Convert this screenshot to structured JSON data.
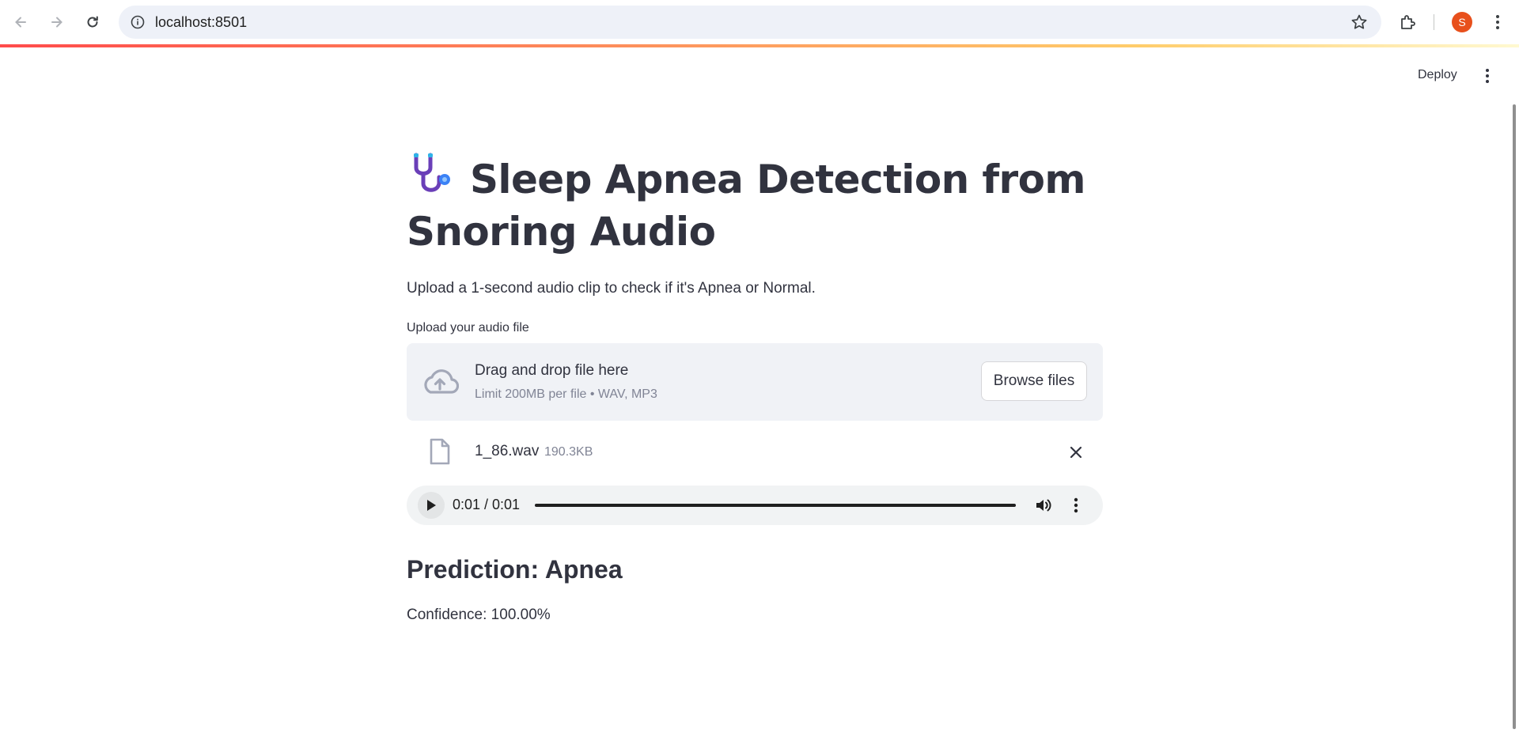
{
  "browser": {
    "url": "localhost:8501",
    "profile_initial": "S",
    "icons": {
      "back": "arrow-left-icon",
      "forward": "arrow-right-icon",
      "reload": "reload-icon",
      "site_info": "info-icon",
      "bookmark": "star-icon",
      "extensions": "puzzle-icon",
      "menu": "vertical-dots-icon"
    }
  },
  "header": {
    "deploy_label": "Deploy"
  },
  "main": {
    "title": "Sleep Apnea Detection from Snoring Audio",
    "title_icon": "stethoscope-icon",
    "subtitle": "Upload a 1-second audio clip to check if it's Apnea or Normal.",
    "uploader": {
      "label": "Upload your audio file",
      "drop_text": "Drag and drop file here",
      "limit_text": "Limit 200MB per file • WAV, MP3",
      "browse_label": "Browse files"
    },
    "file": {
      "name": "1_86.wav",
      "size": "190.3KB"
    },
    "audio_player": {
      "time": "0:01 / 0:01",
      "progress": 1.0
    },
    "prediction": "Prediction: Apnea",
    "confidence": "Confidence: 100.00%"
  },
  "colors": {
    "text": "#31333f",
    "muted": "#808495",
    "dropzone_bg": "#f0f2f6",
    "avatar": "#e8501c",
    "accent_red": "#ff4b4b",
    "accent_blue": "#3b82f6"
  }
}
